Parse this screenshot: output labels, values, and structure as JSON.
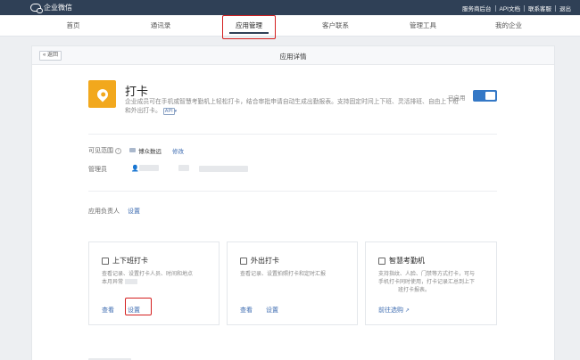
{
  "topbar": {
    "brand": "企业微信",
    "links": [
      "服务商后台",
      "API文档",
      "联系客服",
      "退出"
    ]
  },
  "nav": {
    "items": [
      "首页",
      "通讯录",
      "应用管理",
      "客户联系",
      "管理工具",
      "我的企业"
    ],
    "active_index": 2
  },
  "card": {
    "back_label": "返回",
    "title": "应用详情"
  },
  "app": {
    "name": "打卡",
    "icon": "location-pin-icon",
    "icon_color": "#f2a81d",
    "description": "企业成员可在手机或智慧考勤机上轻松打卡，结合审批申请自动生成出勤报表。支持固定时间上下班、灵活排班、自由上下班和外出打卡。",
    "api_tag": "API",
    "enabled_label": "已启用",
    "enabled": true
  },
  "scope": {
    "label": "可见范围",
    "value": "博众数远",
    "edit": "修改"
  },
  "admin": {
    "label": "管理员"
  },
  "owner": {
    "label": "应用负责人",
    "action": "设置"
  },
  "features": [
    {
      "title": "上下班打卡",
      "icon": "list-icon",
      "desc_lines": [
        "查看记录、设置打卡人员、时间和地点",
        "本月异常"
      ],
      "actions": [
        "查看",
        "设置"
      ]
    },
    {
      "title": "外出打卡",
      "icon": "briefcase-icon",
      "desc_lines": [
        "查看记录、设置拍照打卡和定时汇报"
      ],
      "actions": [
        "查看",
        "设置"
      ]
    },
    {
      "title": "智慧考勤机",
      "icon": "image-icon",
      "desc_lines": [
        "支持指纹、人脸、门禁等方式打卡，可与",
        "手机打卡同时使用，打卡记录汇总到上下",
        "班打卡报表。"
      ],
      "actions": [
        "前往选购"
      ]
    }
  ],
  "colors": {
    "topbar": "#2f4056",
    "accent": "#3478c6",
    "link": "#3e6cb1",
    "highlight": "#d41f1f"
  }
}
